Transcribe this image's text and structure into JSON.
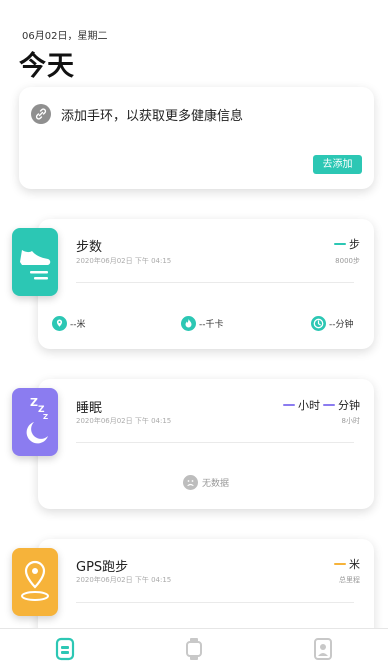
{
  "header": {
    "date": "06月02日，星期二",
    "title": "今天"
  },
  "add_card": {
    "text": "添加手环，以获取更多健康信息",
    "button": "去添加"
  },
  "steps": {
    "title": "步数",
    "time": "2020年06月02日 下午 04:15",
    "value_unit": "步",
    "goal": "8000步",
    "distance": "--米",
    "calories": "--千卡",
    "duration": "--分钟"
  },
  "sleep": {
    "title": "睡眠",
    "time": "2020年06月02日 下午 04:15",
    "hours_unit": "小时",
    "minutes_unit": "分钟",
    "goal": "8小时",
    "no_data": "无数据"
  },
  "gps": {
    "title": "GPS跑步",
    "time": "2020年06月02日 下午 04:15",
    "value_unit": "米",
    "sub": "总里程"
  },
  "colors": {
    "teal": "#2cc7b4",
    "purple": "#8b7cf0",
    "orange": "#f6b33a"
  },
  "tabs": [
    "home-icon",
    "watch-icon",
    "profile-icon"
  ]
}
